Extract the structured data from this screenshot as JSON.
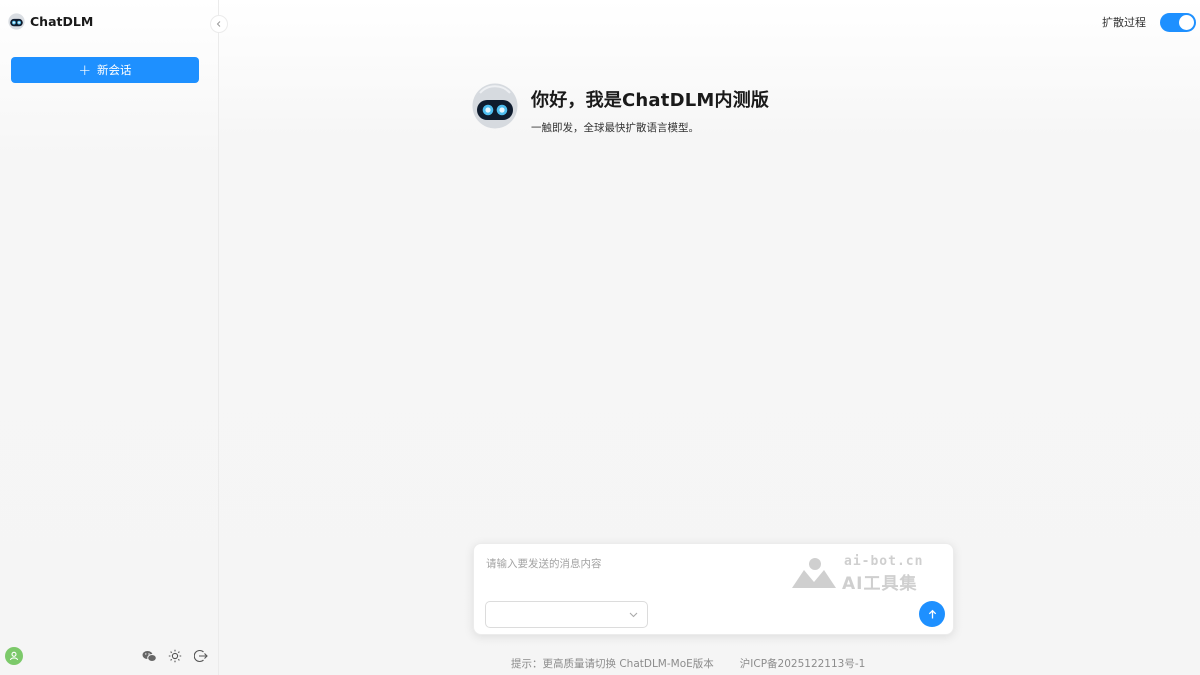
{
  "sidebar": {
    "brand_name": "ChatDLM",
    "new_chat_label": "新会话",
    "icons": {
      "brand_logo": "robot-logo-icon",
      "collapse": "chevron-left-icon",
      "avatar": "user-icon",
      "wechat": "wechat-icon",
      "theme": "sun-icon",
      "logout": "logout-icon"
    }
  },
  "header": {
    "toggle_label": "扩散过程",
    "toggle_on": true
  },
  "welcome": {
    "title": "你好，我是ChatDLM内测版",
    "subtitle": "一触即发，全球最快扩散语言模型。"
  },
  "composer": {
    "placeholder": "请输入要发送的消息内容",
    "value": "",
    "model_selected": "",
    "watermark_url": "ai-bot.cn",
    "watermark_text": "AI工具集"
  },
  "footer": {
    "hint": "提示：更高质量请切换 ChatDLM-MoE版本",
    "icp": "沪ICP备2025122113号-1"
  },
  "colors": {
    "accent": "#1e90ff",
    "avatar": "#7cc96a",
    "background": "#f6f6f6"
  }
}
